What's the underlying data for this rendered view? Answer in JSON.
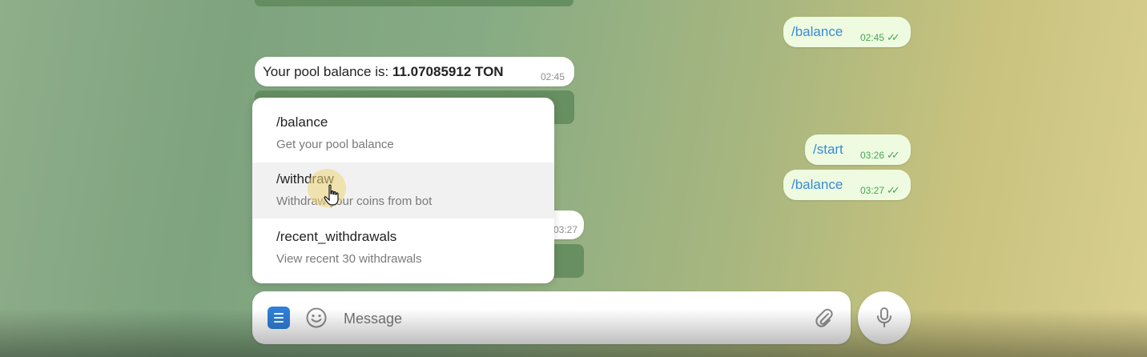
{
  "messages": {
    "out_1": {
      "text": "/balance",
      "time": "02:45"
    },
    "in_1": {
      "prefix": "Your pool balance is: ",
      "amount": "11.07085912 TON",
      "time": "02:45"
    },
    "in_2": {
      "time": "03:27"
    },
    "out_2": {
      "text": "/start",
      "time": "03:26"
    },
    "out_3": {
      "text": "/balance",
      "time": "03:27"
    }
  },
  "commands": [
    {
      "command": "/balance",
      "description": "Get your pool balance"
    },
    {
      "command": "/withdraw",
      "description": "Withdraw your coins from bot"
    },
    {
      "command": "/recent_withdrawals",
      "description": "View recent 30 withdrawals"
    }
  ],
  "input": {
    "placeholder": "Message"
  },
  "icons": {
    "menu": "bot-menu-icon",
    "emoji": "emoji-icon",
    "attach": "paperclip-icon",
    "mic": "microphone-icon",
    "cursor": "hand-pointer-icon",
    "read": "double-check-icon"
  },
  "colors": {
    "accent": "#3a8ad6",
    "menu_button": "#2f7fd8",
    "outgoing_bubble": "#eefbe0",
    "check": "#49a658"
  }
}
